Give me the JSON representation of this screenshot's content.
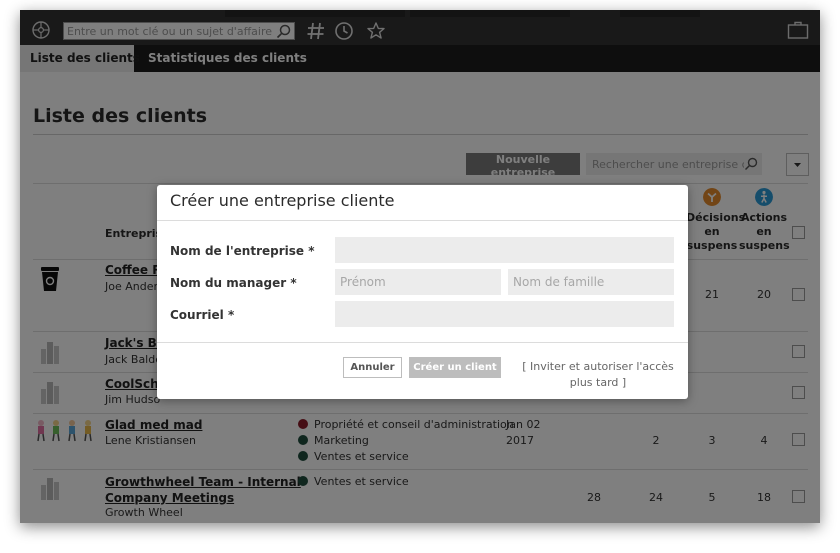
{
  "top_bar": {
    "search_placeholder": "Entre un mot clé ou un sujet d'affaire",
    "icons": [
      "compass-icon",
      "search-icon",
      "hashtag-icon",
      "clock-icon",
      "star-icon",
      "briefcase-icon"
    ]
  },
  "tabs": [
    {
      "label": "Liste des clients",
      "active": true
    },
    {
      "label": "Statistiques des clients",
      "active": false
    }
  ],
  "page": {
    "title": "Liste des clients",
    "new_company_label": "Nouvelle entreprise",
    "search_placeholder": "Rechercher une entreprise cliente"
  },
  "table": {
    "col_company": "Entreprise",
    "col_decisions": [
      "Décisions",
      "en",
      "suspens"
    ],
    "col_actions": [
      "Actions",
      "en",
      "suspens"
    ],
    "rows": [
      {
        "name": "Coffee Re",
        "person": "Joe Ander",
        "tags": [],
        "date": [
          "",
          ""
        ],
        "c1": "",
        "c2": "",
        "decisions": "21",
        "actions": "20"
      },
      {
        "name": "Jack's Ba",
        "person": "Jack Balde",
        "tags": [],
        "date": [
          "",
          ""
        ],
        "c1": "",
        "c2": "",
        "decisions": "",
        "actions": ""
      },
      {
        "name": "CoolScho",
        "person": "Jim Hudso",
        "tags": [],
        "date": [
          "",
          ""
        ],
        "c1": "",
        "c2": "",
        "decisions": "",
        "actions": ""
      },
      {
        "name": "Glad med mad",
        "person": "Lene Kristiansen",
        "tags": [
          {
            "label": "Propriété et conseil d'administration",
            "color": "#8b1a28"
          },
          {
            "label": "Marketing",
            "color": "#1f4d3d"
          },
          {
            "label": "Ventes et service",
            "color": "#1f4d3d"
          }
        ],
        "date": [
          "Jan 02",
          "2017"
        ],
        "c1": "",
        "c2": "2",
        "decisions": "3",
        "actions": "4"
      },
      {
        "name_lines": [
          "Growthwheel Team - Internal",
          "Company Meetings"
        ],
        "person": "Growth Wheel",
        "tags": [
          {
            "label": "Ventes et service",
            "color": "#1f4d3d"
          }
        ],
        "date": [
          "",
          ""
        ],
        "c1": "28",
        "c2": "24",
        "decisions": "5",
        "actions": "18"
      }
    ]
  },
  "modal": {
    "title": "Créer une entreprise cliente",
    "company_label": "Nom de l'entreprise *",
    "company_value": "",
    "manager_label": "Nom du manager *",
    "first_name_placeholder": "Prénom",
    "last_name_placeholder": "Nom de famille",
    "email_label": "Courriel *",
    "email_value": "",
    "cancel_label": "Annuler",
    "create_label": "Créer un client",
    "invite_link": "[ Inviter et autoriser l'accès plus tard ]"
  },
  "colors": {
    "decisions_accent": "#e48a2c",
    "actions_accent": "#2a9bd6",
    "topbar": "#333333",
    "tabbar": "#1c1c1c",
    "overlay": "rgba(0,0,0,0.5)"
  }
}
